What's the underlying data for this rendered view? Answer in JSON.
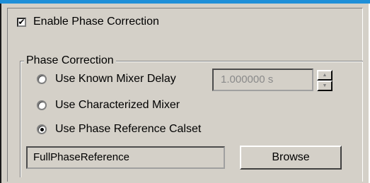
{
  "enable_phase_correction": {
    "label": "Enable Phase Correction",
    "checked": true,
    "check_glyph": "✔"
  },
  "group": {
    "title": "Phase Correction",
    "options": [
      {
        "label": "Use Known Mixer Delay",
        "selected": false
      },
      {
        "label": "Use Characterized Mixer",
        "selected": false
      },
      {
        "label": "Use Phase Reference Calset",
        "selected": true
      }
    ],
    "mixer_delay_value": "1.000000 s",
    "spinner": {
      "up_icon": "▲",
      "down_icon": "▼"
    },
    "calset_value": "FullPhaseReference",
    "browse_label": "Browse"
  },
  "colors": {
    "accent_strip": "#1e8fd8",
    "panel_bg": "#d4d0c8",
    "disabled_text": "#8a8a8a"
  }
}
